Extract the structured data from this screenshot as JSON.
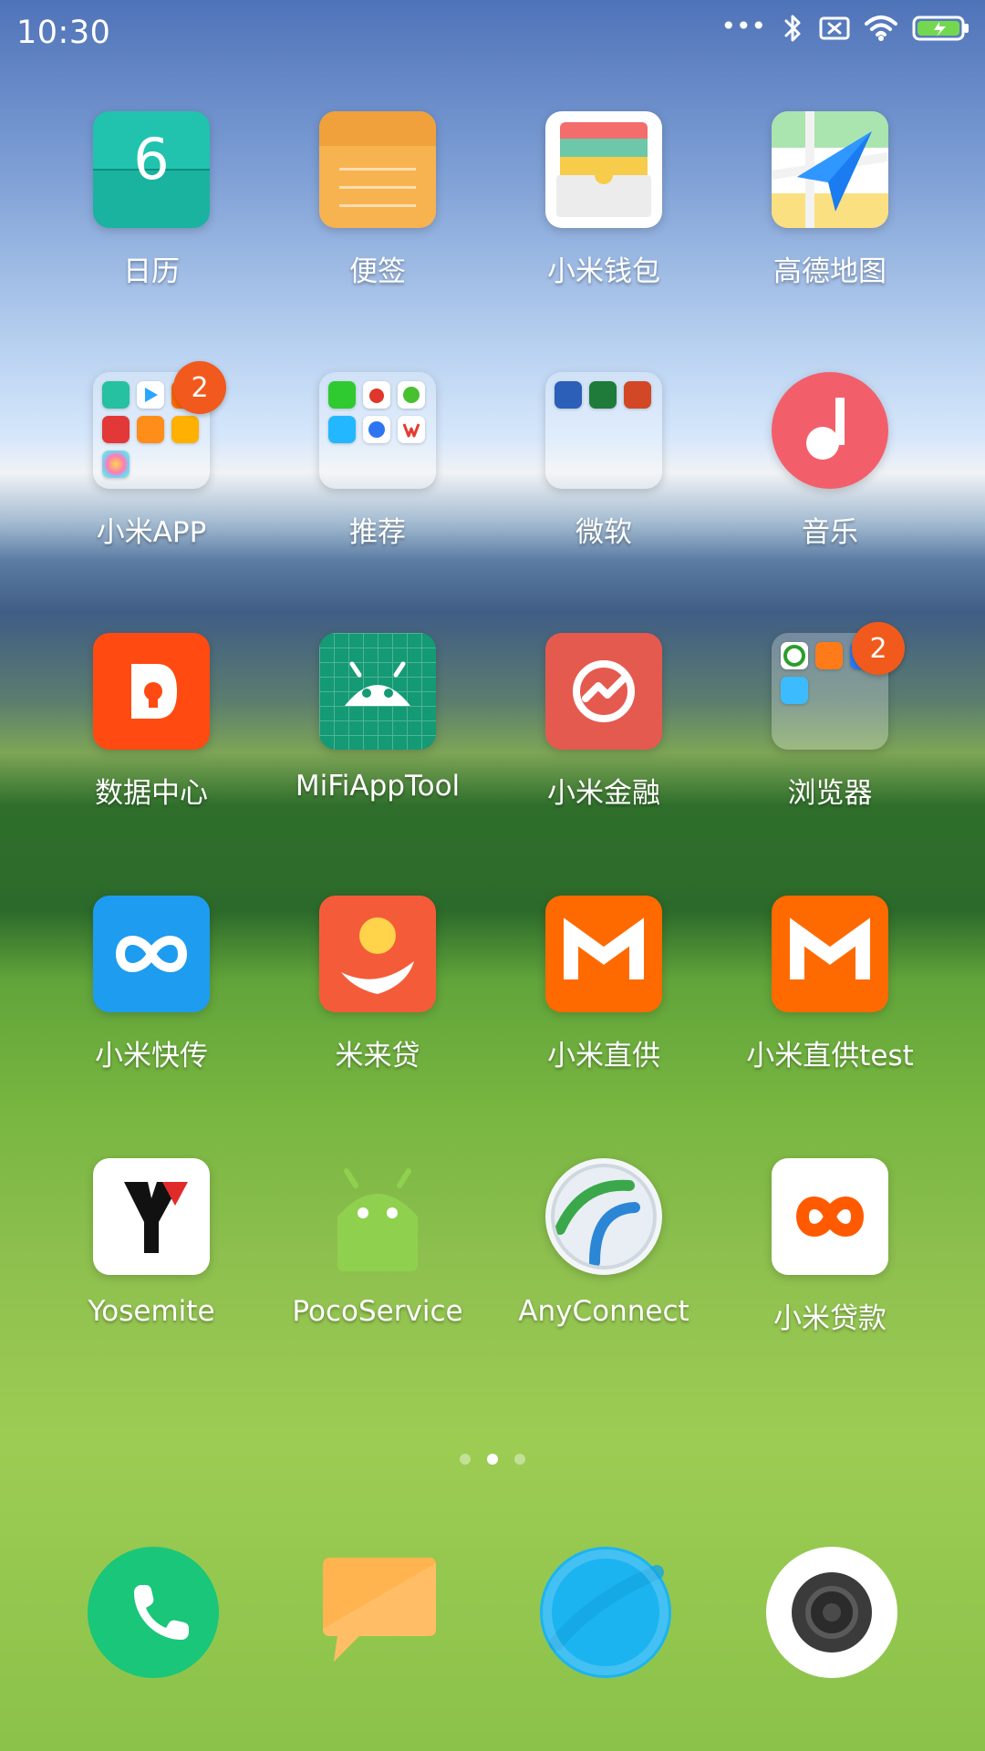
{
  "status_bar": {
    "time": "10:30",
    "dots": "•••",
    "icons": [
      "bluetooth-icon",
      "sim-absent-icon",
      "wifi-icon",
      "battery-charging-icon"
    ]
  },
  "apps": [
    {
      "label": "日历",
      "icon": "calendar-icon",
      "calendar_day": "6"
    },
    {
      "label": "便签",
      "icon": "notes-icon"
    },
    {
      "label": "小米钱包",
      "icon": "wallet-icon"
    },
    {
      "label": "高德地图",
      "icon": "amap-icon"
    },
    {
      "label": "小米APP",
      "icon": "folder-icon",
      "badge": "2"
    },
    {
      "label": "推荐",
      "icon": "folder-icon"
    },
    {
      "label": "微软",
      "icon": "folder-icon"
    },
    {
      "label": "音乐",
      "icon": "music-icon"
    },
    {
      "label": "数据中心",
      "icon": "data-center-icon"
    },
    {
      "label": "MiFiAppTool",
      "icon": "android-tool-icon"
    },
    {
      "label": "小米金融",
      "icon": "mi-finance-icon"
    },
    {
      "label": "浏览器",
      "icon": "folder-icon",
      "badge": "2"
    },
    {
      "label": "小米快传",
      "icon": "mi-drop-icon"
    },
    {
      "label": "米来贷",
      "icon": "loan-icon"
    },
    {
      "label": "小米直供",
      "icon": "mi-store-icon"
    },
    {
      "label": "小米直供test",
      "icon": "mi-store-test-icon"
    },
    {
      "label": "Yosemite",
      "icon": "yosemite-icon"
    },
    {
      "label": "PocoService",
      "icon": "android-icon"
    },
    {
      "label": "AnyConnect",
      "icon": "anyconnect-icon"
    },
    {
      "label": "小米贷款",
      "icon": "mi-loan-icon"
    }
  ],
  "page_indicator": {
    "count": 3,
    "active_index": 1
  },
  "dock": [
    {
      "name": "phone",
      "icon": "phone-icon"
    },
    {
      "name": "messages",
      "icon": "message-icon"
    },
    {
      "name": "browser",
      "icon": "browser-icon"
    },
    {
      "name": "camera",
      "icon": "camera-icon"
    }
  ],
  "colors": {
    "badge": "#f15a1c",
    "calendar": "#1ab3a0",
    "notes": "#f6b350",
    "music": "#f25f6b",
    "data_center": "#ff4a12",
    "android_tool": "#149a74",
    "mi_finance": "#e55a4f",
    "mi_drop": "#1d9cf0",
    "loan": "#f45c39",
    "mi_store": "#ff6a00",
    "mi_loan": "#ff5a00",
    "phone": "#19c67a",
    "message": "#ffb44f",
    "browser": "#1cb4f0",
    "camera": "#ffffff"
  }
}
